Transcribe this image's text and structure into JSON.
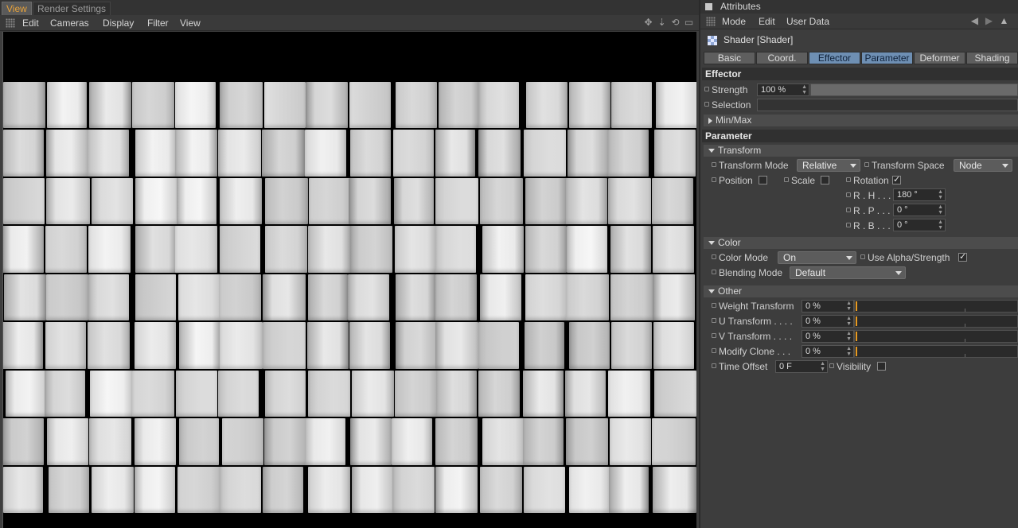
{
  "viewport": {
    "tabs": [
      {
        "label": "View",
        "active": true
      },
      {
        "label": "Render Settings",
        "active": false
      }
    ],
    "menu": [
      "Edit",
      "Cameras",
      "Display",
      "Filter",
      "View"
    ],
    "nav_icons": [
      "move-icon",
      "zoom-icon",
      "rotate-icon",
      "maximize-icon"
    ],
    "scene": {
      "columns": 16,
      "rows": 9,
      "background": "#000000",
      "tile_color": "#e6e6e6"
    }
  },
  "attributes": {
    "title": "Attributes",
    "menu": [
      "Mode",
      "Edit",
      "User Data"
    ],
    "object_name": "Shader [Shader]",
    "tabs": [
      {
        "label": "Basic",
        "active": false
      },
      {
        "label": "Coord.",
        "active": false
      },
      {
        "label": "Effector",
        "active": true
      },
      {
        "label": "Parameter",
        "active": true
      },
      {
        "label": "Deformer",
        "active": false
      },
      {
        "label": "Shading",
        "active": false
      }
    ],
    "effector": {
      "heading": "Effector",
      "strength_label": "Strength",
      "strength_value": "100 %",
      "strength_fraction": 1.0,
      "selection_label": "Selection",
      "minmax_label": "Min/Max"
    },
    "parameter": {
      "heading": "Parameter",
      "transform": {
        "group_label": "Transform",
        "mode_label": "Transform Mode",
        "mode_value": "Relative",
        "space_label": "Transform Space",
        "space_value": "Node",
        "position_label": "Position",
        "position_checked": false,
        "scale_label": "Scale",
        "scale_checked": false,
        "rotation_label": "Rotation",
        "rotation_checked": true,
        "rh_label": "R . H . . .",
        "rh_value": "180 °",
        "rp_label": "R . P . . .",
        "rp_value": "0 °",
        "rb_label": "R . B . . .",
        "rb_value": "0 °"
      },
      "color": {
        "group_label": "Color",
        "mode_label": "Color Mode",
        "mode_value": "On",
        "alpha_label": "Use Alpha/Strength",
        "alpha_checked": true,
        "blend_label": "Blending Mode",
        "blend_value": "Default"
      },
      "other": {
        "group_label": "Other",
        "weight_label": "Weight Transform",
        "weight_value": "0 %",
        "u_label": "U Transform . . . .",
        "u_value": "0 %",
        "v_label": "V Transform . . . .",
        "v_value": "0 %",
        "modify_label": "Modify Clone . . .",
        "modify_value": "0 %",
        "time_label": "Time Offset",
        "time_value": "0 F",
        "visibility_label": "Visibility",
        "visibility_checked": false
      }
    }
  },
  "colors": {
    "accent": "#e8a33a",
    "tab_active": "#6e8fb3",
    "slider_knob": "#e89a20"
  }
}
